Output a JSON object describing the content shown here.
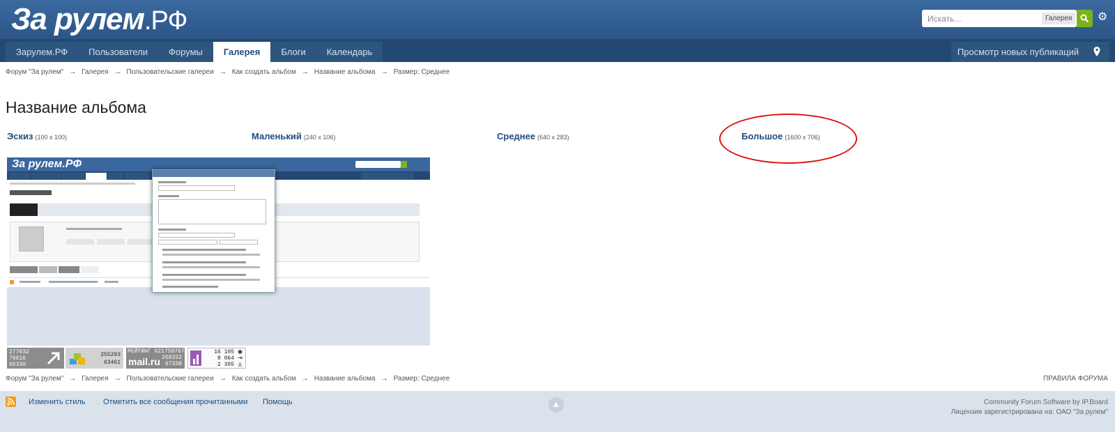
{
  "header": {
    "logo_main": "За рулем",
    "logo_suffix": ".РФ",
    "search_placeholder": "Искать...",
    "search_scope": "Галерея"
  },
  "nav": {
    "tabs": [
      {
        "label": "Зарулем.РФ"
      },
      {
        "label": "Пользователи"
      },
      {
        "label": "Форумы"
      },
      {
        "label": "Галерея",
        "active": true
      },
      {
        "label": "Блоги"
      },
      {
        "label": "Календарь"
      }
    ],
    "new_content": "Просмотр новых публикаций"
  },
  "breadcrumb": [
    "Форум \"За рулем\"",
    "Галерея",
    "Пользовательские галереи",
    "Как создать альбом",
    "Название альбома",
    "Размер: Среднее"
  ],
  "breadcrumb_sep": "→",
  "page_title": "Название альбома",
  "sizes": [
    {
      "label": "Эскиз",
      "dim": "(100 x 100)"
    },
    {
      "label": "Маленький",
      "dim": "(240 x 106)"
    },
    {
      "label": "Среднее",
      "dim": "(640 x 283)"
    },
    {
      "label": "Большое",
      "dim": "(1600 x 706)"
    }
  ],
  "counters": {
    "c1": [
      "277032",
      "76616",
      "65330"
    ],
    "c2": [
      "255293",
      "63461"
    ],
    "c3": [
      "РЕЙТИНГ 621759767",
      "258332",
      "67338",
      "mail.ru"
    ],
    "c4": [
      "16 195",
      "8 064",
      "2 395"
    ]
  },
  "forum_rules": "ПРАВИЛА ФОРУМА",
  "footer": {
    "change_style": "Изменить стиль",
    "mark_read": "Отметить все сообщения прочитанными",
    "help": "Помощь",
    "powered_by": "Community Forum Software by IP.Board",
    "license": "Лицензия зарегистрирована на: ОАО \"За рулем\""
  },
  "colors": {
    "header": "#3b6aa0",
    "nav": "#234873",
    "link": "#1f4d7e",
    "highlight_circle": "#dd1111",
    "search_button": "#7bb31b"
  }
}
